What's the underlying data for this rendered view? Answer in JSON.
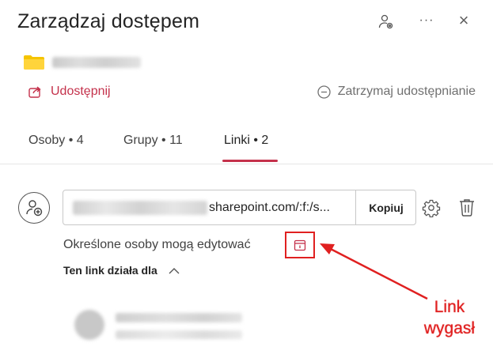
{
  "header": {
    "title": "Zarządzaj dostępem",
    "icons": [
      "people-settings-icon",
      "more-icon",
      "close-icon"
    ],
    "more_label": "···",
    "close_label": "×"
  },
  "item": {
    "icon": "folder-icon",
    "folder_color": "#f5c400"
  },
  "actions": {
    "share_label": "Udostępnij",
    "share_icon": "share-icon",
    "stop_label": "Zatrzymaj udostępnianie",
    "stop_icon": "stop-icon"
  },
  "tabs": [
    {
      "label": "Osoby • 4",
      "active": false
    },
    {
      "label": "Grupy • 11",
      "active": false
    },
    {
      "label": "Linki • 2",
      "active": true
    }
  ],
  "link": {
    "url_visible": "sharepoint.com/:f:/s...",
    "copy_label": "Kopiuj",
    "permission_text": "Określone osoby mogą edytować",
    "works_for_label": "Ten link działa dla",
    "icons": [
      "add-person-icon",
      "settings-icon",
      "trash-icon",
      "calendar-icon",
      "chevron-up-icon"
    ]
  },
  "annotation": {
    "line1": "Link",
    "line2": "wygasł",
    "color": "#e02020"
  },
  "colors": {
    "accent": "#c4314b",
    "text": "#242424",
    "muted": "#707070"
  }
}
